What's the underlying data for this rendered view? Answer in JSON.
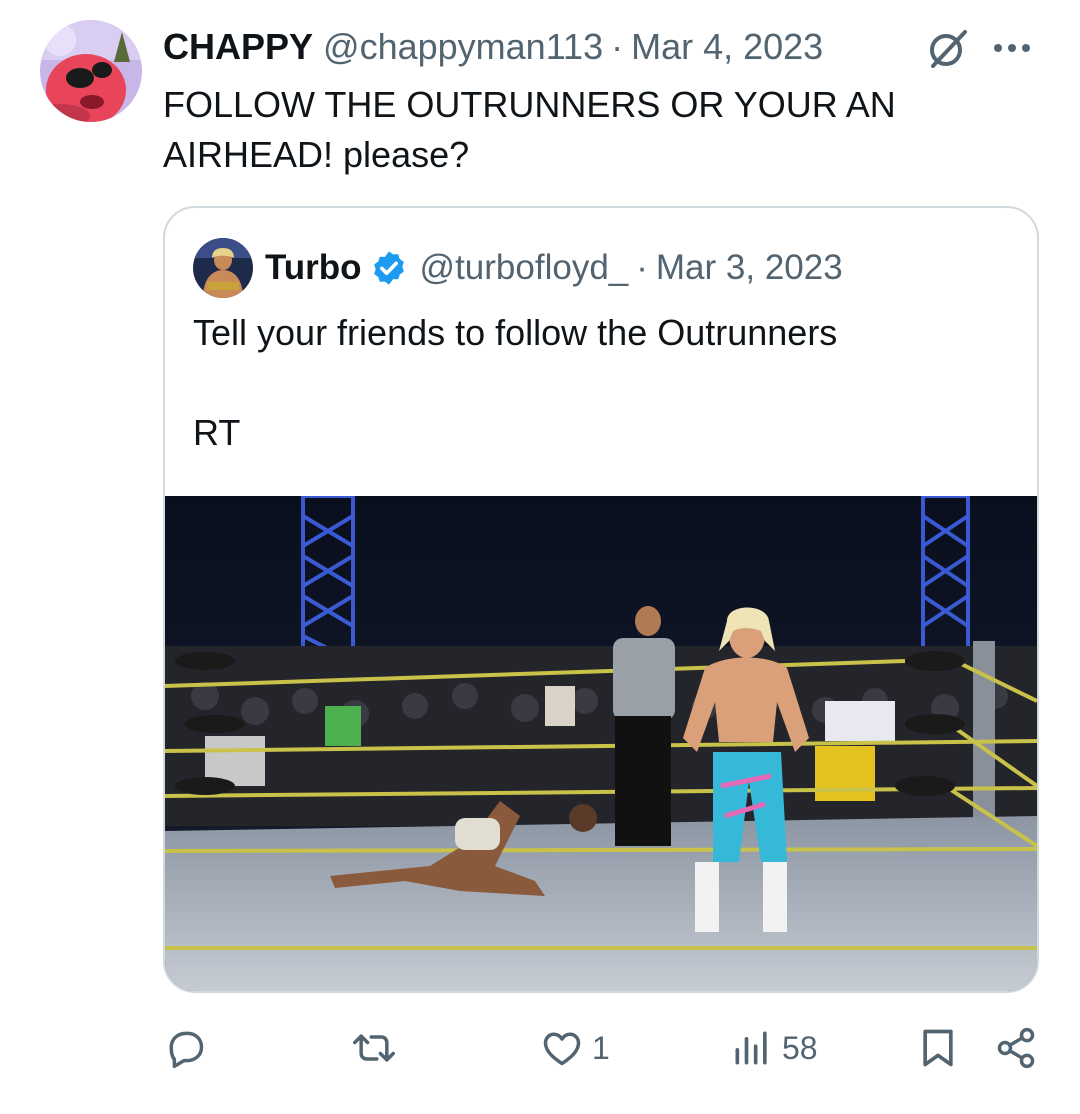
{
  "tweet": {
    "display_name": "CHAPPY",
    "handle": "@chappyman113",
    "separator": "·",
    "date": "Mar 4, 2023",
    "text_line1": "FOLLOW THE OUTRUNNERS OR YOUR AN",
    "text_line2": "AIRHEAD! please?",
    "icons": [
      "grok-icon",
      "more-icon"
    ]
  },
  "quote": {
    "display_name": "Turbo",
    "verified": true,
    "handle": "@turbofloyd_",
    "separator": "·",
    "date": "Mar 3, 2023",
    "text_line1": "Tell your friends to follow the Outrunners",
    "text_line2": "RT"
  },
  "actions": {
    "reply_count": "",
    "retweet_count": "",
    "like_count": "1",
    "views_count": "58"
  },
  "colors": {
    "text_primary": "#0f1419",
    "text_secondary": "#536471",
    "border": "#cfd9de",
    "verified_blue": "#1d9bf0"
  }
}
